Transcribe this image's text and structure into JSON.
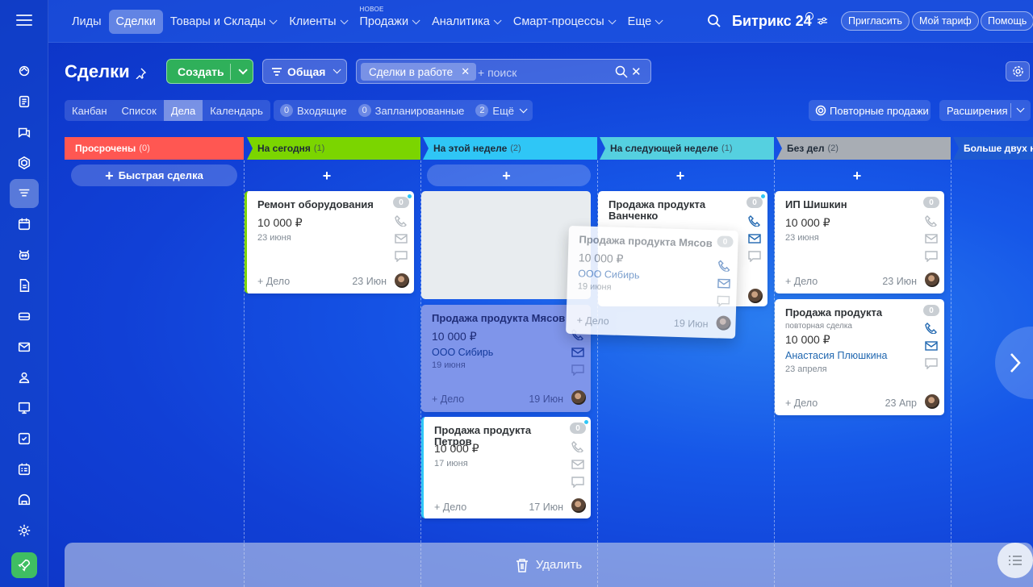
{
  "colors": {
    "overdue": "#ff5752",
    "today": "#7bd500",
    "this_week": "#2fc6f6",
    "next_week": "#55d0e0",
    "no_tasks": "#a8adb4",
    "more_than_two_weeks": "#1e5ad0",
    "create_button": "#2fb05a",
    "link": "#2067b0"
  },
  "nav": {
    "items": [
      {
        "label": "Лиды",
        "icon": "none"
      },
      {
        "label": "Сделки",
        "icon": "none"
      },
      {
        "label": "Товары и Склады",
        "icon": "chevron-down-icon"
      },
      {
        "label": "Клиенты",
        "icon": "chevron-down-icon"
      },
      {
        "label": "Продажи",
        "icon": "chevron-down-icon",
        "badge": "НОВОЕ"
      },
      {
        "label": "Аналитика",
        "icon": "chevron-down-icon"
      },
      {
        "label": "Смарт-процессы",
        "icon": "chevron-down-icon"
      },
      {
        "label": "Еще",
        "icon": "chevron-down-icon"
      }
    ],
    "active": "Сделки",
    "brand": "Битрикс 24",
    "invite": "Пригласить",
    "tariff": "Мой тариф",
    "help": "Помощь"
  },
  "sidebar": {
    "icons": [
      "menu-icon",
      "crm-icon",
      "feed-icon",
      "chat-icon",
      "hexagon-icon",
      "deals-funnel-icon",
      "calendar-icon",
      "robot-icon",
      "document-icon",
      "storage-icon",
      "mail-icon",
      "contacts-icon",
      "presentation-icon",
      "tasks-icon",
      "schedule-icon",
      "sites-icon",
      "settings-icon",
      "rocket-icon"
    ]
  },
  "header": {
    "title": "Сделки",
    "create_label": "Создать",
    "category_label": "Общая",
    "filter_tag": "Сделки в работе",
    "search_placeholder": "+ поиск"
  },
  "views": [
    "Канбан",
    "Список",
    "Дела",
    "Календарь"
  ],
  "active_view": "Дела",
  "counters": [
    {
      "count": "0",
      "label": "Входящие"
    },
    {
      "count": "0",
      "label": "Запланированные"
    },
    {
      "count": "2",
      "label": "Ещё"
    }
  ],
  "repeat_sales": "Повторные продажи",
  "extensions": "Расширения",
  "columns": [
    {
      "name": "Просрочены",
      "count": "(0)"
    },
    {
      "name": "На сегодня",
      "count": "(1)"
    },
    {
      "name": "На этой неделе",
      "count": "(2)"
    },
    {
      "name": "На следующей неделе",
      "count": "(1)"
    },
    {
      "name": "Без дел",
      "count": "(2)"
    },
    {
      "name": "Больше двух не",
      "count": ""
    }
  ],
  "quick_deal": "Быстрая сделка",
  "cards": {
    "today_1": {
      "title": "Ремонт оборудования",
      "price": "10 000 ₽",
      "date": "23 июня",
      "deal": "+ Дело",
      "day": "23 Июн",
      "badge": "0"
    },
    "week_1": {
      "title": "Продажа продукта Мясов",
      "price": "10 000 ₽",
      "client": "ООО Сибирь",
      "date": "19 июня",
      "deal": "+ Дело",
      "day": "19 Июн"
    },
    "week_2": {
      "title": "Продажа продукта Петров",
      "price": "10 000 ₽",
      "date": "17 июня",
      "deal": "+ Дело",
      "day": "17 Июн",
      "badge": "0"
    },
    "next_1": {
      "title": "Продажа продукта Ванченко",
      "badge": "0"
    },
    "drag_1": {
      "title": "Продажа продукта Мясов",
      "price": "10 000 ₽",
      "client": "ООО Сибирь",
      "date": "19 июня",
      "deal": "+ Дело",
      "day": "19 Июн",
      "badge": "0"
    },
    "none_1": {
      "title": "ИП Шишкин",
      "price": "10 000 ₽",
      "date": "23 июня",
      "deal": "+ Дело",
      "day": "23 Июн",
      "badge": "0"
    },
    "none_2": {
      "title": "Продажа продукта",
      "subtitle": "повторная сделка",
      "price": "10 000 ₽",
      "client": "Анастасия Плюшкина",
      "date": "23 апреля",
      "deal": "+ Дело",
      "day": "23 Апр",
      "badge": "0"
    }
  },
  "delete_label": "Удалить"
}
